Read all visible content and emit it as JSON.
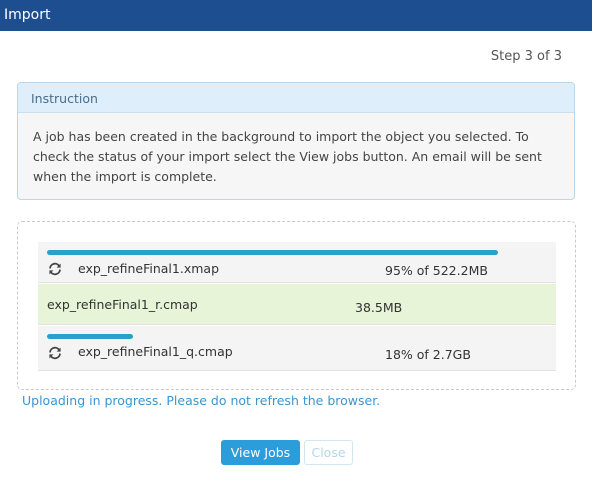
{
  "window": {
    "title": "Import"
  },
  "wizard": {
    "step": "Step 3 of 3"
  },
  "instruction": {
    "heading": "Instruction",
    "lines": [
      "A job has been created in the background to import the object you selected. To",
      "check the status of your import select the View jobs button. An email will be sent",
      "when the import is complete."
    ]
  },
  "uploads": [
    {
      "name": "exp_refineFinal1.xmap",
      "size": "95% of 522.2MB",
      "progress": 0.95,
      "status": "uploading"
    },
    {
      "name": "exp_refineFinal1_r.cmap",
      "size": "38.5MB",
      "progress": 1.0,
      "status": "done"
    },
    {
      "name": "exp_refineFinal1_q.cmap",
      "size": "18% of 2.7GB",
      "progress": 0.18,
      "status": "uploading"
    }
  ],
  "status_message": "Uploading in progress. Please do not refresh the browser.",
  "buttons": {
    "view_jobs": "View Jobs",
    "close": "Close"
  },
  "colors": {
    "titlebar": "#1d4e8f",
    "progress": "#2aa1c9",
    "done_row": "#e7f4d8",
    "primary_button": "#2c9ddb"
  }
}
